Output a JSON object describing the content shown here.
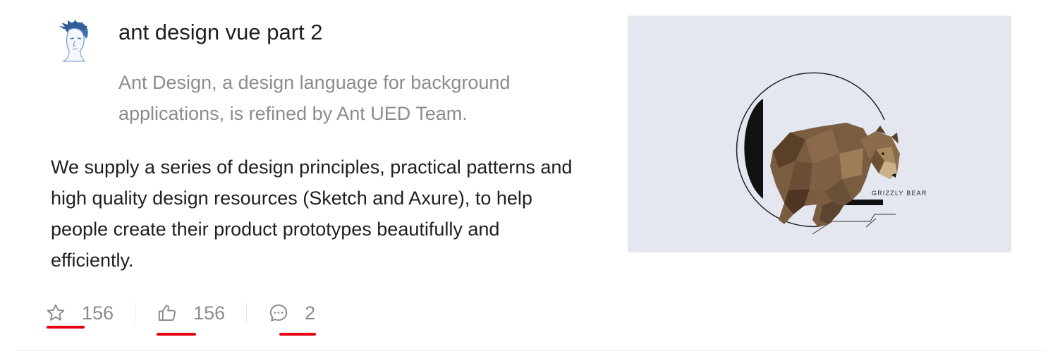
{
  "item": {
    "title": "ant design vue part 2",
    "description": "Ant Design, a design language for background applications, is refined by Ant UED Team.",
    "content": "We supply a series of design principles, practical patterns and high quality design resources (Sketch and Axure), to help people create their product prototypes beautifully and efficiently.",
    "cover_caption": "GRIZZLY BEAR"
  },
  "actions": [
    {
      "icon": "star-icon",
      "count": "156"
    },
    {
      "icon": "like-icon",
      "count": "156"
    },
    {
      "icon": "message-icon",
      "count": "2"
    }
  ],
  "colors": {
    "annotation_underline": "#e60012",
    "cover_background": "#e4e7ef",
    "muted_text": "#8c8c8c"
  }
}
